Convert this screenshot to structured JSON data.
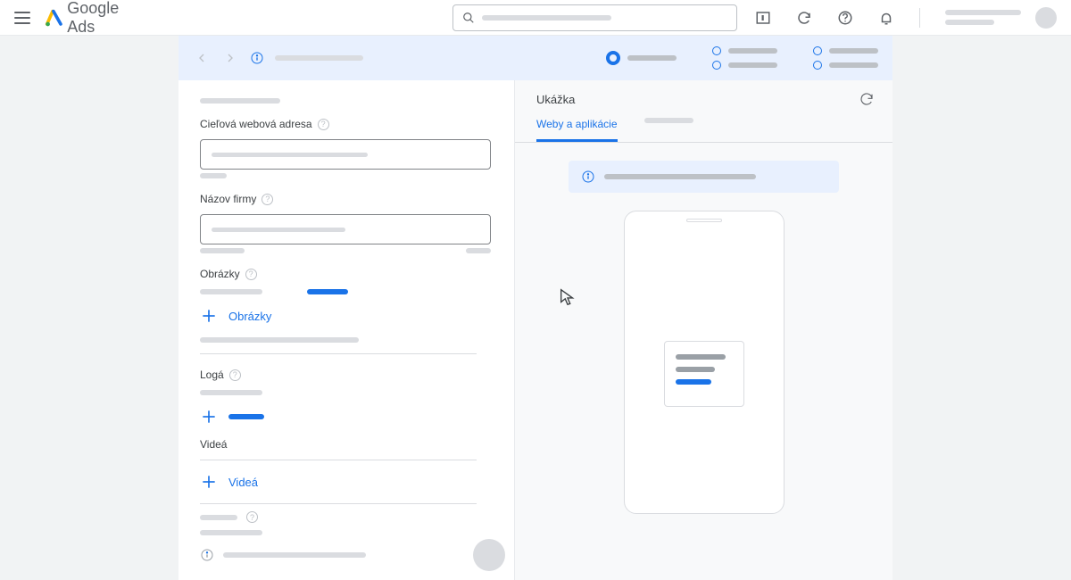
{
  "header": {
    "product_prefix": "Google",
    "product_suffix": " Ads"
  },
  "form": {
    "url_label": "Cieľová webová adresa",
    "name_label": "Názov firmy",
    "images_label": "Obrázky",
    "add_images": "Obrázky",
    "logos_label": "Logá",
    "videos_label": "Videá",
    "add_videos": "Videá"
  },
  "preview": {
    "title": "Ukážka",
    "tab_web": "Weby a aplikácie"
  }
}
